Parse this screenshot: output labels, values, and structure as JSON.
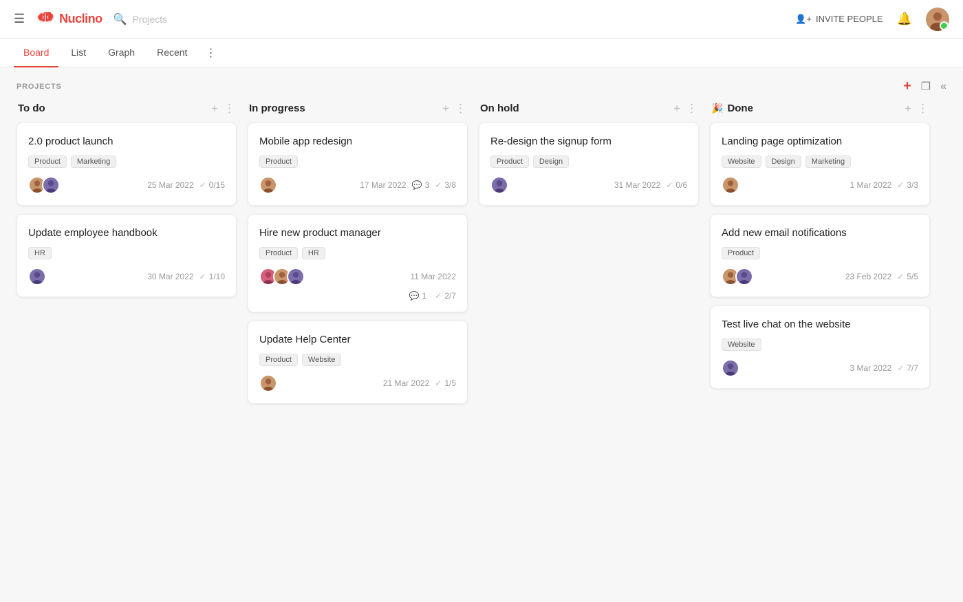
{
  "topbar": {
    "logo_text": "Nuclino",
    "search_placeholder": "Projects",
    "invite_label": "INVITE PEOPLE",
    "tabs": [
      {
        "id": "board",
        "label": "Board",
        "active": true
      },
      {
        "id": "list",
        "label": "List",
        "active": false
      },
      {
        "id": "graph",
        "label": "Graph",
        "active": false
      },
      {
        "id": "recent",
        "label": "Recent",
        "active": false
      }
    ]
  },
  "projects_section": {
    "label": "PROJECTS"
  },
  "columns": [
    {
      "id": "todo",
      "title": "To do",
      "emoji": "",
      "cards": [
        {
          "id": "c1",
          "title": "2.0 product launch",
          "tags": [
            "Product",
            "Marketing"
          ],
          "avatars": [
            "tan",
            "purple"
          ],
          "date": "25 Mar 2022",
          "checks": "0/15",
          "comments": null
        },
        {
          "id": "c2",
          "title": "Update employee handbook",
          "tags": [
            "HR"
          ],
          "avatars": [
            "purple"
          ],
          "date": "30 Mar 2022",
          "checks": "1/10",
          "comments": null
        }
      ]
    },
    {
      "id": "inprogress",
      "title": "In progress",
      "emoji": "",
      "cards": [
        {
          "id": "c3",
          "title": "Mobile app redesign",
          "tags": [
            "Product"
          ],
          "avatars": [
            "tan"
          ],
          "date": "17 Mar 2022",
          "checks": "3/8",
          "comments": "3"
        },
        {
          "id": "c4",
          "title": "Hire new product manager",
          "tags": [
            "Product",
            "HR"
          ],
          "avatars": [
            "pink",
            "tan",
            "purple"
          ],
          "date": "11 Mar 2022",
          "checks": "2/7",
          "comments": "1"
        },
        {
          "id": "c5",
          "title": "Update Help Center",
          "tags": [
            "Product",
            "Website"
          ],
          "avatars": [
            "tan"
          ],
          "date": "21 Mar 2022",
          "checks": "1/5",
          "comments": null
        }
      ]
    },
    {
      "id": "onhold",
      "title": "On hold",
      "emoji": "",
      "cards": [
        {
          "id": "c6",
          "title": "Re-design the signup form",
          "tags": [
            "Product",
            "Design"
          ],
          "avatars": [
            "purple"
          ],
          "date": "31 Mar 2022",
          "checks": "0/6",
          "comments": null
        }
      ]
    },
    {
      "id": "done",
      "title": "Done",
      "emoji": "🎉",
      "cards": [
        {
          "id": "c7",
          "title": "Landing page optimization",
          "tags": [
            "Website",
            "Design",
            "Marketing"
          ],
          "avatars": [
            "tan"
          ],
          "date": "1 Mar 2022",
          "checks": "3/3",
          "comments": null
        },
        {
          "id": "c8",
          "title": "Add new email notifications",
          "tags": [
            "Product"
          ],
          "avatars": [
            "tan",
            "purple"
          ],
          "date": "23 Feb 2022",
          "checks": "5/5",
          "comments": null
        },
        {
          "id": "c9",
          "title": "Test live chat on the website",
          "tags": [
            "Website"
          ],
          "avatars": [
            "purple"
          ],
          "date": "3 Mar 2022",
          "checks": "7/7",
          "comments": null
        }
      ]
    }
  ]
}
